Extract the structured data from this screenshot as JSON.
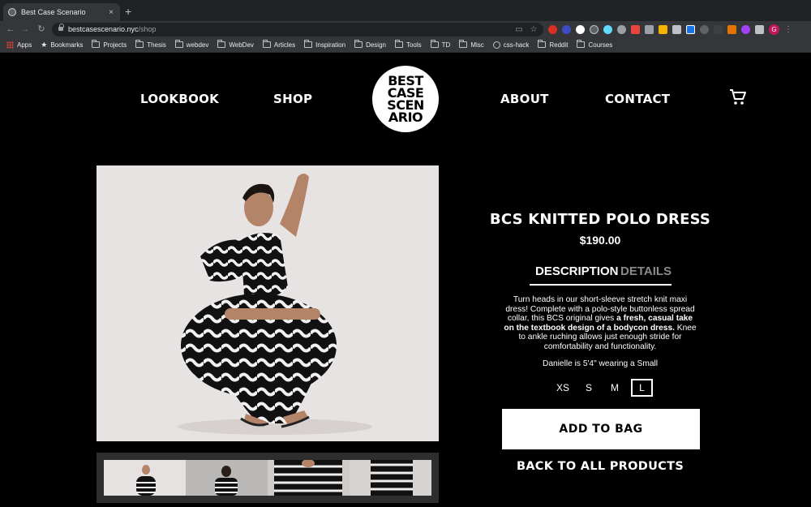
{
  "browser": {
    "tab_title": "Best Case Scenario",
    "tab_close": "×",
    "new_tab": "+",
    "url_host": "bestcasescenario.nyc",
    "url_path": "/shop",
    "profile_initial": "G",
    "bookmarks": [
      "Apps",
      "Bookmarks",
      "Projects",
      "Thesis",
      "webdev",
      "WebDev",
      "Articles",
      "Inspiration",
      "Design",
      "Tools",
      "TD",
      "Misc",
      "css-hack",
      "Reddit",
      "Courses"
    ]
  },
  "site": {
    "nav": {
      "lookbook": "LOOKBOOK",
      "shop": "SHOP",
      "about": "ABOUT",
      "contact": "CONTACT"
    },
    "logo_lines": [
      "BEST",
      "CASE",
      "SCEN",
      "ARIO"
    ]
  },
  "product": {
    "title": "BCS KNITTED POLO DRESS",
    "price": "$190.00",
    "tabs": {
      "description": "DESCRIPTION",
      "details": "DETAILS"
    },
    "desc_part1": "Turn heads in our short-sleeve stretch knit maxi dress! Complete with a polo-style buttonless spread collar, this BCS original gives ",
    "desc_bold": "a fresh, casual take on the textbook design of a bodycon dress.",
    "desc_part2": " Knee to ankle ruching allows just enough stride for comfortability and functionality.",
    "model_note": "Danielle is 5'4\" wearing a Small",
    "sizes": [
      "XS",
      "S",
      "M",
      "L"
    ],
    "selected_size": "L",
    "add_to_bag": "ADD TO BAG",
    "back_link": "BACK TO ALL PRODUCTS"
  },
  "colors": {
    "background": "#000000",
    "button_bg": "#ffffff",
    "inactive_tab": "#8a8a8a"
  }
}
